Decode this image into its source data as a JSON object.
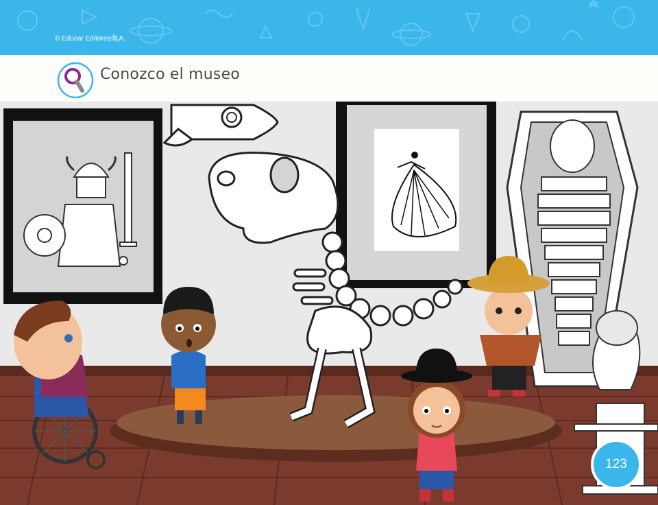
{
  "header": {
    "copyright": "© Educar Editores S.A.",
    "background_color": "#3bb6ea"
  },
  "section": {
    "title": "Conozco el museo",
    "icon": "magnifying-glass-icon",
    "icon_color": "#8a2b8f"
  },
  "scene": {
    "description_icons": [
      "viking-artwork",
      "rocket",
      "dinosaur-skeleton",
      "dancer-artwork",
      "mummy-sarcophagus",
      "greek-bust",
      "child-in-wheelchair",
      "curly-haired-child",
      "girl-with-black-hat",
      "boy-with-straw-hat-and-poncho"
    ],
    "wall_color": "#e9e9e9",
    "floor_color": "#7a3b2e"
  },
  "page": {
    "number": "123",
    "badge_color": "#3bb6ea"
  }
}
